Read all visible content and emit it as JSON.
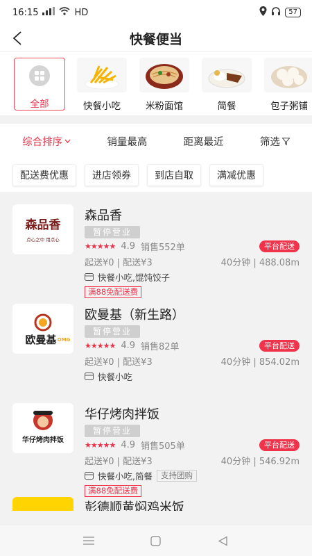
{
  "status_bar": {
    "time": "16:15",
    "network": "HD",
    "battery": "57"
  },
  "header": {
    "title": "快餐便当"
  },
  "categories": [
    {
      "label": "全部",
      "icon": "grid-icon",
      "active": true
    },
    {
      "label": "快餐小吃",
      "icon": "fries-icon"
    },
    {
      "label": "米粉面馆",
      "icon": "noodles-icon"
    },
    {
      "label": "简餐",
      "icon": "meal-icon"
    },
    {
      "label": "包子粥铺",
      "icon": "bun-icon"
    }
  ],
  "sort": {
    "items": [
      "综合排序",
      "销量最高",
      "距离最近",
      "筛选"
    ],
    "active_color": "#e8334a"
  },
  "filters": [
    "配送费优惠",
    "进店领券",
    "到店自取",
    "满减优惠"
  ],
  "stores": [
    {
      "name": "森品香",
      "status": "暂停营业",
      "score": "4.9",
      "sales": "销售552单",
      "delivery_badge": "平台配送",
      "min_order": "起送¥0 | 配送¥3",
      "time_distance": "40分钟 | 488.08m",
      "categories": "快餐小吃,馄饨饺子",
      "extra_tag": "",
      "promo": "满88免配送费",
      "logo_text": "森品香",
      "logo_sub": "点心之中 用点心"
    },
    {
      "name": "欧曼基（新生路）",
      "status": "暂停营业",
      "score": "4.9",
      "sales": "销售82单",
      "delivery_badge": "平台配送",
      "min_order": "起送¥0 | 配送¥3",
      "time_distance": "40分钟 | 854.02m",
      "categories": "快餐小吃",
      "extra_tag": "",
      "promo": "",
      "logo_text": "欧曼基",
      "logo_sub": "OMG"
    },
    {
      "name": "华仔烤肉拌饭",
      "status": "暂停营业",
      "score": "4.9",
      "sales": "销售505单",
      "delivery_badge": "平台配送",
      "min_order": "起送¥0 | 配送¥3",
      "time_distance": "40分钟 | 546.92m",
      "categories": "快餐小吃,简餐",
      "extra_tag": "支持团购",
      "promo": "满88免配送费",
      "logo_text": "华仔烤肉拌饭",
      "logo_sub": ""
    }
  ],
  "peek_store": {
    "name": "彭德顺黄焖鸡米饭"
  }
}
